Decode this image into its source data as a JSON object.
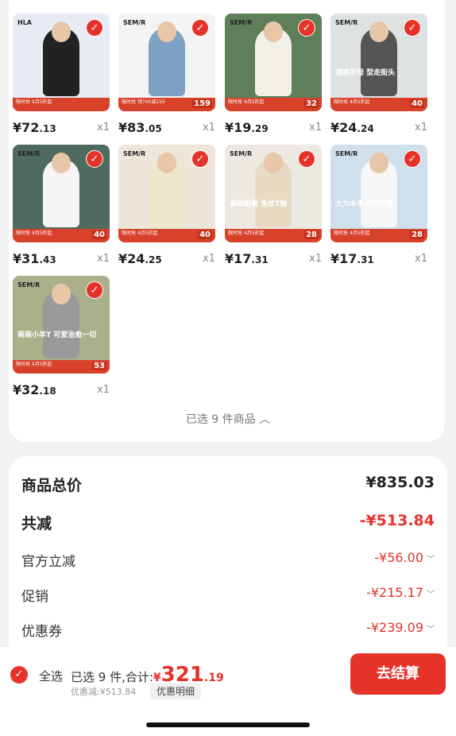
{
  "products": [
    {
      "brand": "HLA",
      "tag": "",
      "banner": "限时抢 4月5折起",
      "bprice": "",
      "int": "¥72",
      "dec": ".13",
      "qty": "x1",
      "bg": "#e7ecf4",
      "shirt": "#222"
    },
    {
      "brand": "SEM/R",
      "tag": "",
      "banner": "限时抢 领700减150",
      "bprice": "159",
      "int": "¥83",
      "dec": ".05",
      "qty": "x1",
      "bg": "#f3f3f3",
      "shirt": "#7ea2c4"
    },
    {
      "brand": "SEM/R",
      "tag": "",
      "banner": "限时抢 4月5折起",
      "bprice": "32",
      "int": "¥19",
      "dec": ".29",
      "qty": "x1",
      "bg": "#5f7e5a",
      "shirt": "#f2efe8"
    },
    {
      "brand": "SEM/R",
      "tag": "潮感字母 型走街头",
      "banner": "限时抢 4月5折起",
      "bprice": "40",
      "int": "¥24",
      "dec": ".24",
      "qty": "x1",
      "bg": "#dfe2e2",
      "shirt": "#555"
    },
    {
      "brand": "SEM/R",
      "tag": "",
      "banner": "限时抢 4月5折起",
      "bprice": "40",
      "int": "¥31",
      "dec": ".43",
      "qty": "x1",
      "bg": "#4f6a5e",
      "shirt": "#f5f5f5"
    },
    {
      "brand": "SEM/R",
      "tag": "",
      "banner": "限时抢 4月5折起",
      "bprice": "40",
      "int": "¥24",
      "dec": ".25",
      "qty": "x1",
      "bg": "#ece6db",
      "shirt": "#efe7c9"
    },
    {
      "brand": "SEM/R",
      "tag": "基础耐看 条纹T恤",
      "banner": "限时抢 4月5折起",
      "bprice": "28",
      "int": "¥17",
      "dec": ".31",
      "qty": "x1",
      "bg": "#ece8e2",
      "shirt": "#e8d9c3"
    },
    {
      "brand": "SEM/R",
      "tag": "大力水手 印花T恤",
      "banner": "限时抢 4月5折起",
      "bprice": "28",
      "int": "¥17",
      "dec": ".31",
      "qty": "x1",
      "bg": "#cfe0ec",
      "shirt": "#f7f7f7"
    },
    {
      "brand": "SEM/R",
      "tag": "萌萌小羊T 可爱治愈一切",
      "banner": "限时抢 4月5折起",
      "bprice": "53",
      "int": "¥32",
      "dec": ".18",
      "qty": "x1",
      "bg": "#a9b08a",
      "shirt": "#9a9a9a"
    }
  ],
  "selected_info": "已选 9 件商品",
  "summary": {
    "total_label": "商品总价",
    "total_value": "¥835.03",
    "reduce_label": "共减",
    "reduce_value": "-¥513.84",
    "official_label": "官方立减",
    "official_value": "-¥56.00",
    "promo_label": "促销",
    "promo_value": "-¥215.17",
    "coupon_label": "优惠券",
    "coupon_value": "-¥239.09"
  },
  "bar": {
    "select_all": "全选",
    "selected_prefix": "已选 9 件,合计:",
    "total_symbol": "¥",
    "total_int": "321",
    "total_dec": ".19",
    "discount": "优惠减:¥513.84",
    "detail": "优惠明细",
    "checkout": "去结算"
  },
  "colors": {
    "accent": "#e5332a",
    "banner": "#d8412a"
  },
  "icons": {
    "check": "check-icon",
    "chevron_up": "chevron-up-icon",
    "chevron_down": "chevron-down-icon"
  }
}
